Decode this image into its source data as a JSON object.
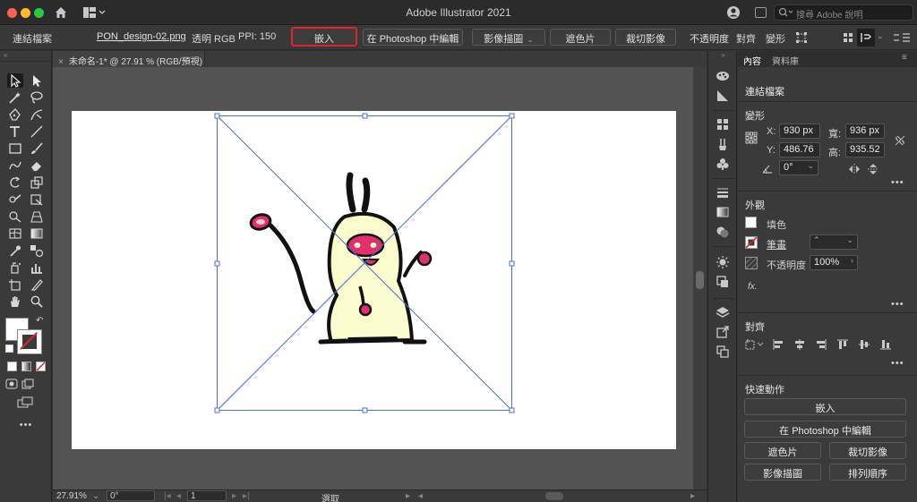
{
  "titlebar": {
    "title": "Adobe Illustrator 2021",
    "search_placeholder": "搜尋 Adobe 說明"
  },
  "controlbar": {
    "linked_file": "連結檔案",
    "filename": "PON_design-02.png",
    "color_info": "透明 RGB",
    "ppi": "PPI: 150",
    "embed": "嵌入",
    "edit_in_photoshop": "在 Photoshop 中編輯",
    "image_trace": "影像描圖",
    "mask": "遮色片",
    "crop_image": "裁切影像",
    "opacity": "不透明度",
    "align": "對齊",
    "transform": "變形"
  },
  "document": {
    "tab_title": "未命名-1* @ 27.91 % (RGB/預視)"
  },
  "statusbar": {
    "zoom": "27.91%",
    "rotation": "0°",
    "artboard_num": "1",
    "tool_status": "選取"
  },
  "panel": {
    "tabs": [
      "內容",
      "資料庫"
    ],
    "title": "連結檔案",
    "transform": {
      "header": "變形",
      "x_label": "X:",
      "x_value": "930 px",
      "y_label": "Y:",
      "y_value": "486.76",
      "w_label": "寬:",
      "w_value": "936 px",
      "h_label": "高:",
      "h_value": "935.52",
      "angle_value": "0°"
    },
    "appearance": {
      "header": "外觀",
      "fill": "填色",
      "stroke": "筆畫",
      "opacity_label": "不透明度",
      "opacity_value": "100%",
      "fx": "fx."
    },
    "align_header": "對齊",
    "quick_actions": {
      "header": "快速動作",
      "embed": "嵌入",
      "edit_in_photoshop": "在 Photoshop 中編輯",
      "mask": "遮色片",
      "crop_image": "裁切影像",
      "image_trace": "影像描圖",
      "arrange": "排列順序"
    },
    "more": "•••"
  },
  "colors": {
    "highlight": "#e0242f",
    "selection": "#4a6fd8",
    "character_body": "#fbfccd",
    "character_pink": "#e0306e"
  }
}
